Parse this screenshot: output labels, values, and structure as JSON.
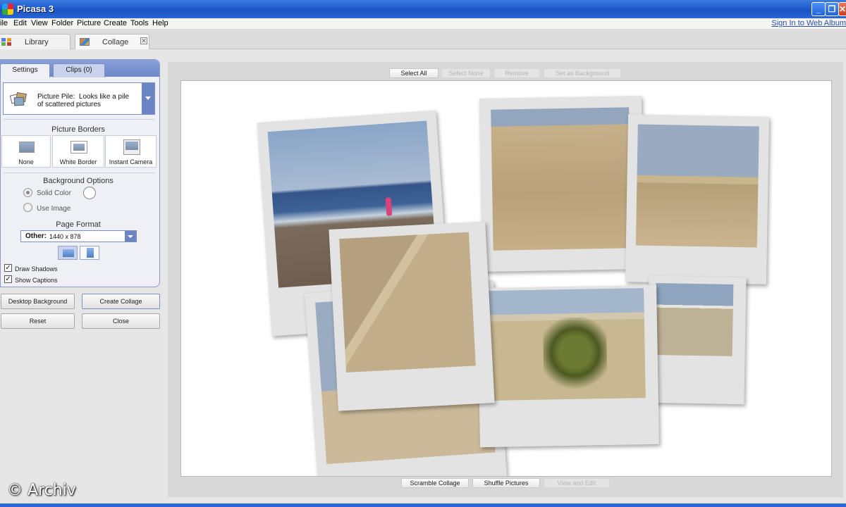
{
  "window": {
    "title": "Picasa 3",
    "minimize": "_",
    "maximize": "❐",
    "close": "✕"
  },
  "menu": {
    "items": [
      "ile",
      "Edit",
      "View",
      "Folder",
      "Picture",
      "Create",
      "Tools",
      "Help"
    ],
    "signin": "Sign In to Web Album"
  },
  "top_tabs": {
    "library": "Library",
    "collage": "Collage",
    "collage_close": "✕"
  },
  "panel": {
    "tabs": {
      "settings": "Settings",
      "clips": "Clips (0)"
    },
    "style": {
      "label": "Picture Pile:",
      "description": "Looks like a pile of scattered pictures"
    },
    "borders": {
      "title": "Picture Borders",
      "options": [
        "None",
        "White Border",
        "Instant Camera"
      ]
    },
    "background": {
      "title": "Background Options",
      "solid_color": "Solid Color",
      "use_image": "Use Image",
      "selected": "Solid Color",
      "swatch_color": "#ffffff"
    },
    "page_format": {
      "title": "Page Format",
      "label": "Other:",
      "value": "1440 x 878",
      "orientation": "landscape"
    },
    "checks": {
      "draw_shadows": "Draw Shadows",
      "show_captions": "Show Captions",
      "draw_shadows_checked": true,
      "show_captions_checked": true,
      "mark": "✓"
    },
    "buttons": {
      "desktop_background": "Desktop Background",
      "create_collage": "Create Collage",
      "reset": "Reset",
      "close": "Close"
    }
  },
  "toolbar_top": {
    "select_all": "Select All",
    "select_none": "Select None",
    "remove": "Remove",
    "set_as_background": "Set as Background"
  },
  "toolbar_bottom": {
    "scramble": "Scramble Collage",
    "shuffle": "Shuffle Pictures",
    "view_edit": "View and Edit"
  },
  "watermark": "© Archiv",
  "colors": {
    "titlebar": "#1f5ccc",
    "panel_accent": "#6d87c8",
    "canvas": "#ffffff"
  }
}
